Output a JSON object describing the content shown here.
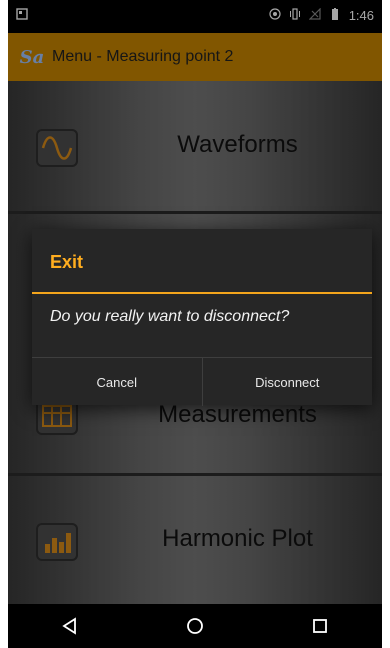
{
  "status_bar": {
    "time": "1:46",
    "icons": [
      "notification-icon",
      "hotspot-icon",
      "vibrate-icon",
      "no-signal-icon",
      "battery-icon"
    ]
  },
  "app_bar": {
    "logo_text": "Sa",
    "title": "Menu - Measuring point 2"
  },
  "menu": {
    "items": [
      {
        "label": "Waveforms",
        "icon": "waveform-icon"
      },
      {
        "label": "Measurements",
        "icon": "table-icon"
      },
      {
        "label": "Harmonic Plot",
        "icon": "bar-chart-icon"
      }
    ]
  },
  "dialog": {
    "title": "Exit",
    "message": "Do you really want to disconnect?",
    "cancel_label": "Cancel",
    "confirm_label": "Disconnect"
  },
  "nav_bar": {
    "buttons": [
      "back-icon",
      "home-icon",
      "recents-icon"
    ]
  },
  "colors": {
    "accent": "#f4a51c",
    "app_bar": "#c68400"
  }
}
